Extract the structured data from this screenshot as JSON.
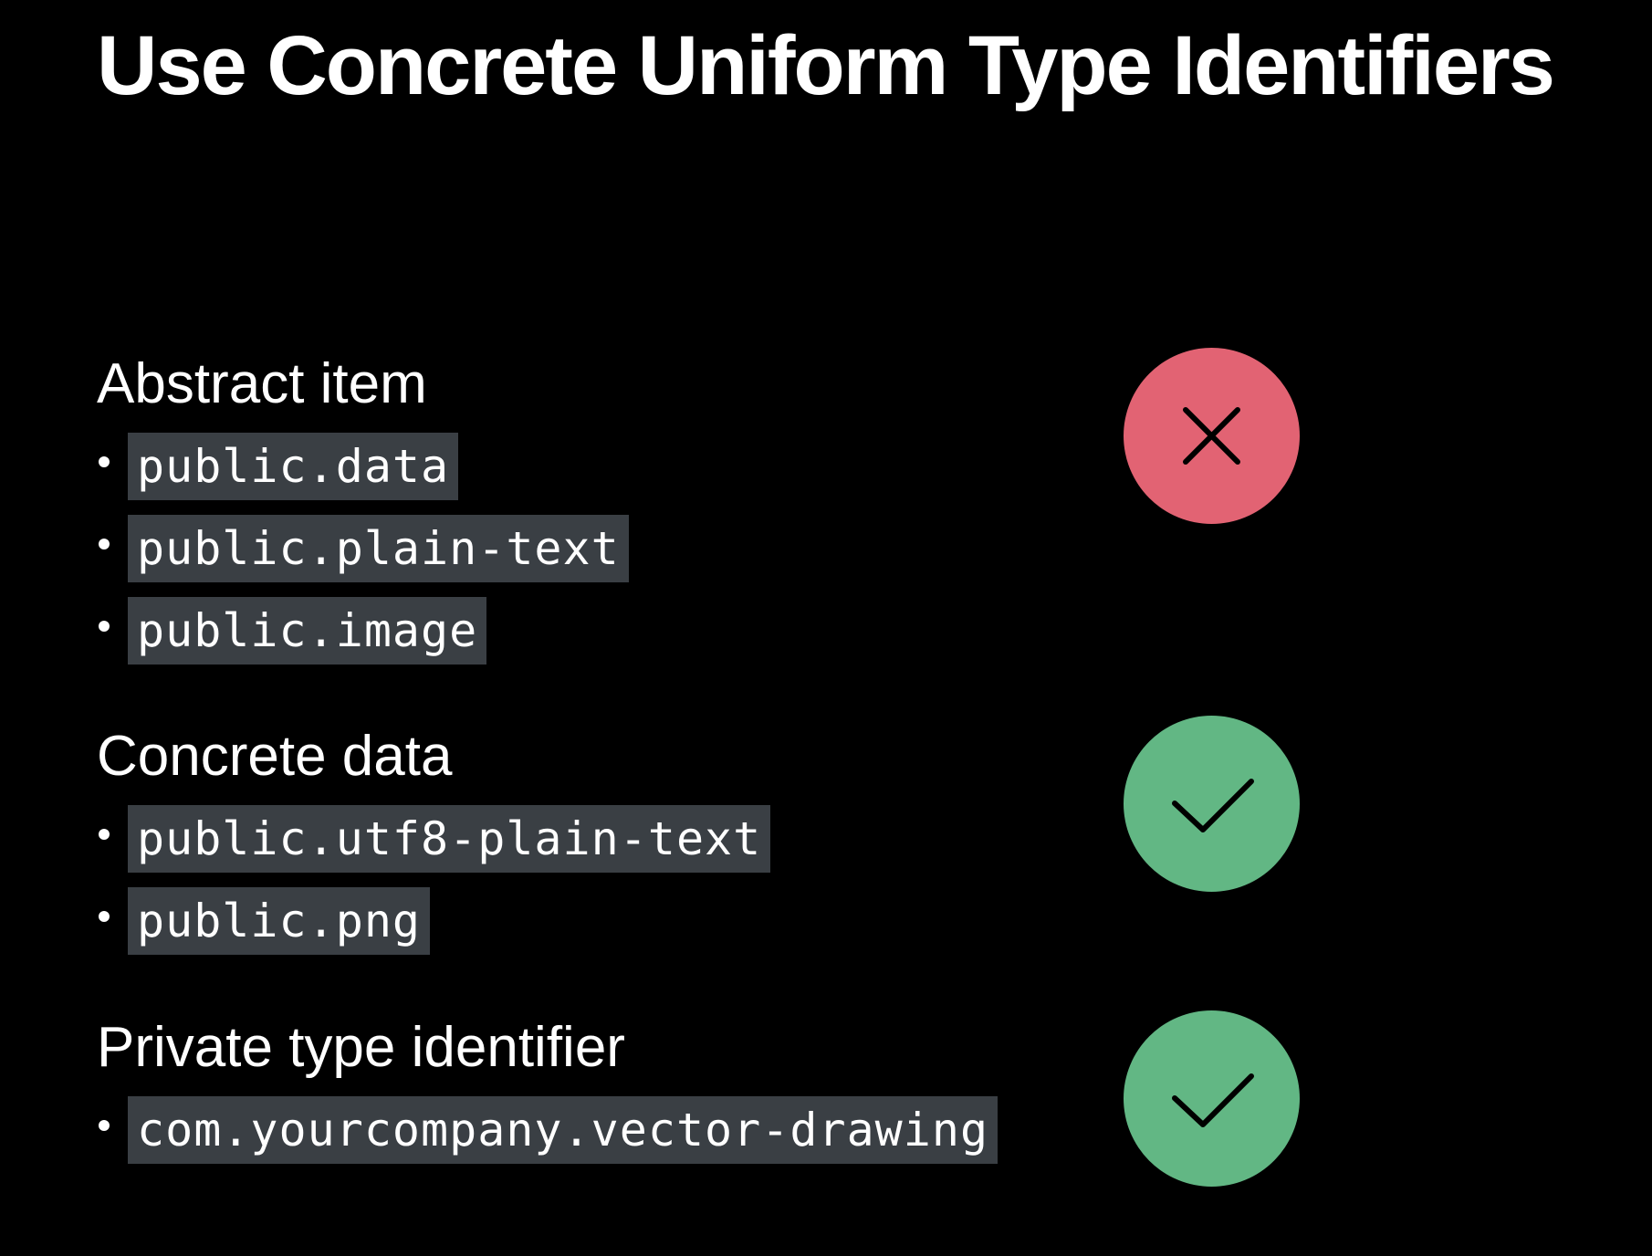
{
  "slide": {
    "title": "Use Concrete Uniform Type Identifiers"
  },
  "sections": [
    {
      "heading": "Abstract item",
      "items": [
        "public.data",
        "public.plain-text",
        "public.image"
      ],
      "status": "invalid",
      "status_icon": "x-icon",
      "status_color": "#e26373"
    },
    {
      "heading": "Concrete data",
      "items": [
        "public.utf8-plain-text",
        "public.png"
      ],
      "status": "valid",
      "status_icon": "checkmark-icon",
      "status_color": "#62b784"
    },
    {
      "heading": "Private type identifier",
      "items": [
        "com.yourcompany.vector-drawing"
      ],
      "status": "valid",
      "status_icon": "checkmark-icon",
      "status_color": "#62b784"
    }
  ],
  "colors": {
    "background": "#000000",
    "text": "#ffffff",
    "code_background": "#3a3f44",
    "icon_stroke": "#000000"
  }
}
